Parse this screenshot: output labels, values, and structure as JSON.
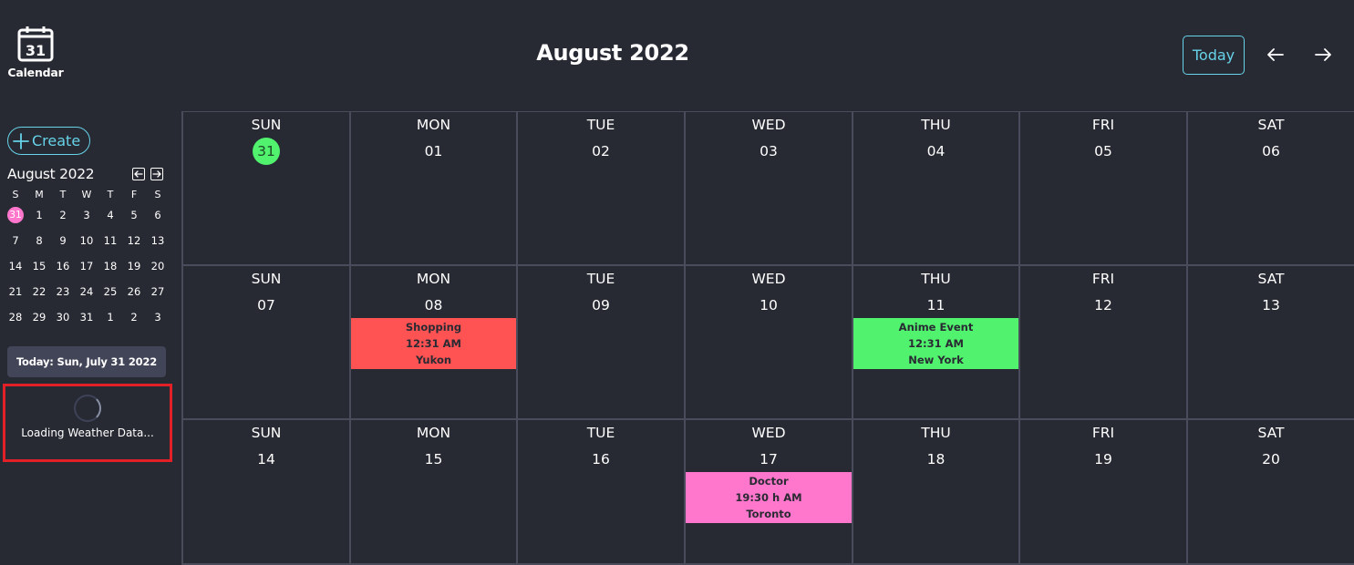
{
  "app": {
    "logo_day": "31",
    "logo_label": "Calendar"
  },
  "header": {
    "month_title": "August 2022",
    "today_label": "Today"
  },
  "sidebar": {
    "create_label": "Create",
    "mini_title": "August 2022",
    "mini_weekdays": [
      "S",
      "M",
      "T",
      "W",
      "T",
      "F",
      "S"
    ],
    "mini_days": [
      "31",
      "1",
      "2",
      "3",
      "4",
      "5",
      "6",
      "7",
      "8",
      "9",
      "10",
      "11",
      "12",
      "13",
      "14",
      "15",
      "16",
      "17",
      "18",
      "19",
      "20",
      "21",
      "22",
      "23",
      "24",
      "25",
      "26",
      "27",
      "28",
      "29",
      "30",
      "31",
      "1",
      "2",
      "3"
    ],
    "mini_selected_index": 0,
    "today_text": "Today: Sun, July 31 2022",
    "weather_text": "Loading Weather Data..."
  },
  "calendar": {
    "weeks": [
      [
        {
          "dow": "SUN",
          "date": "31",
          "today": true
        },
        {
          "dow": "MON",
          "date": "01"
        },
        {
          "dow": "TUE",
          "date": "02"
        },
        {
          "dow": "WED",
          "date": "03"
        },
        {
          "dow": "THU",
          "date": "04"
        },
        {
          "dow": "FRI",
          "date": "05"
        },
        {
          "dow": "SAT",
          "date": "06"
        }
      ],
      [
        {
          "dow": "SUN",
          "date": "07"
        },
        {
          "dow": "MON",
          "date": "08",
          "event": {
            "title": "Shopping",
            "time": "12:31 AM",
            "location": "Yukon",
            "color": "#ff5253"
          }
        },
        {
          "dow": "TUE",
          "date": "09"
        },
        {
          "dow": "WED",
          "date": "10"
        },
        {
          "dow": "THU",
          "date": "11",
          "event": {
            "title": "Anime Event",
            "time": "12:31 AM",
            "location": "New York",
            "color": "#50f26e"
          }
        },
        {
          "dow": "FRI",
          "date": "12"
        },
        {
          "dow": "SAT",
          "date": "13"
        }
      ],
      [
        {
          "dow": "SUN",
          "date": "14"
        },
        {
          "dow": "MON",
          "date": "15"
        },
        {
          "dow": "TUE",
          "date": "16"
        },
        {
          "dow": "WED",
          "date": "17",
          "event": {
            "title": "Doctor",
            "time": "19:30 h AM",
            "location": "Toronto",
            "color": "#ff77cd"
          }
        },
        {
          "dow": "THU",
          "date": "18"
        },
        {
          "dow": "FRI",
          "date": "19"
        },
        {
          "dow": "SAT",
          "date": "20"
        }
      ]
    ]
  },
  "colors": {
    "background": "#272933",
    "accent": "#67d3e8",
    "today_marker": "#50f26e",
    "mini_selected": "#ff77cd",
    "weather_box_border": "#e32027"
  },
  "icons": {
    "logo": "calendar-icon",
    "prev": "arrow-left-icon",
    "next": "arrow-right-icon",
    "create": "plus-icon"
  }
}
